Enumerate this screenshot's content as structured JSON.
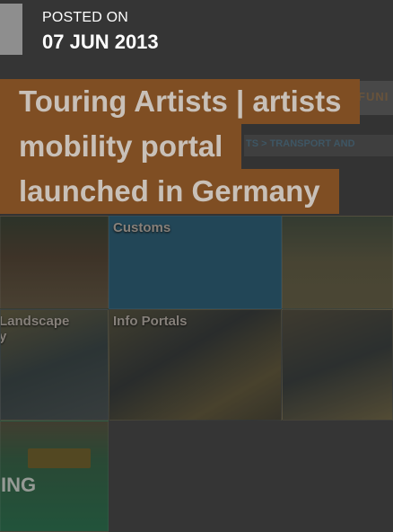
{
  "post": {
    "posted_label": "POSTED ON",
    "date": "07 JUN 2013",
    "title_lines": [
      "Touring Artists | artists",
      "mobility portal",
      "launched in Germany"
    ]
  },
  "background": {
    "nav_fragment": "FUNI",
    "breadcrumb_fragment": "TS > TRANSPORT AND",
    "tiles": [
      {
        "label": ""
      },
      {
        "label": "Customs"
      },
      {
        "label": ""
      },
      {
        "label": "Landscape\ny"
      },
      {
        "label": "Info Portals"
      },
      {
        "label": ""
      },
      {
        "label": "ING"
      }
    ]
  },
  "colors": {
    "title_background": "#7f4e23",
    "title_text": "#c8c0b8",
    "date_accent": "#8e8e8e",
    "dim_overlay": "#3a3a3a",
    "customs_tile": "#1f5670"
  }
}
